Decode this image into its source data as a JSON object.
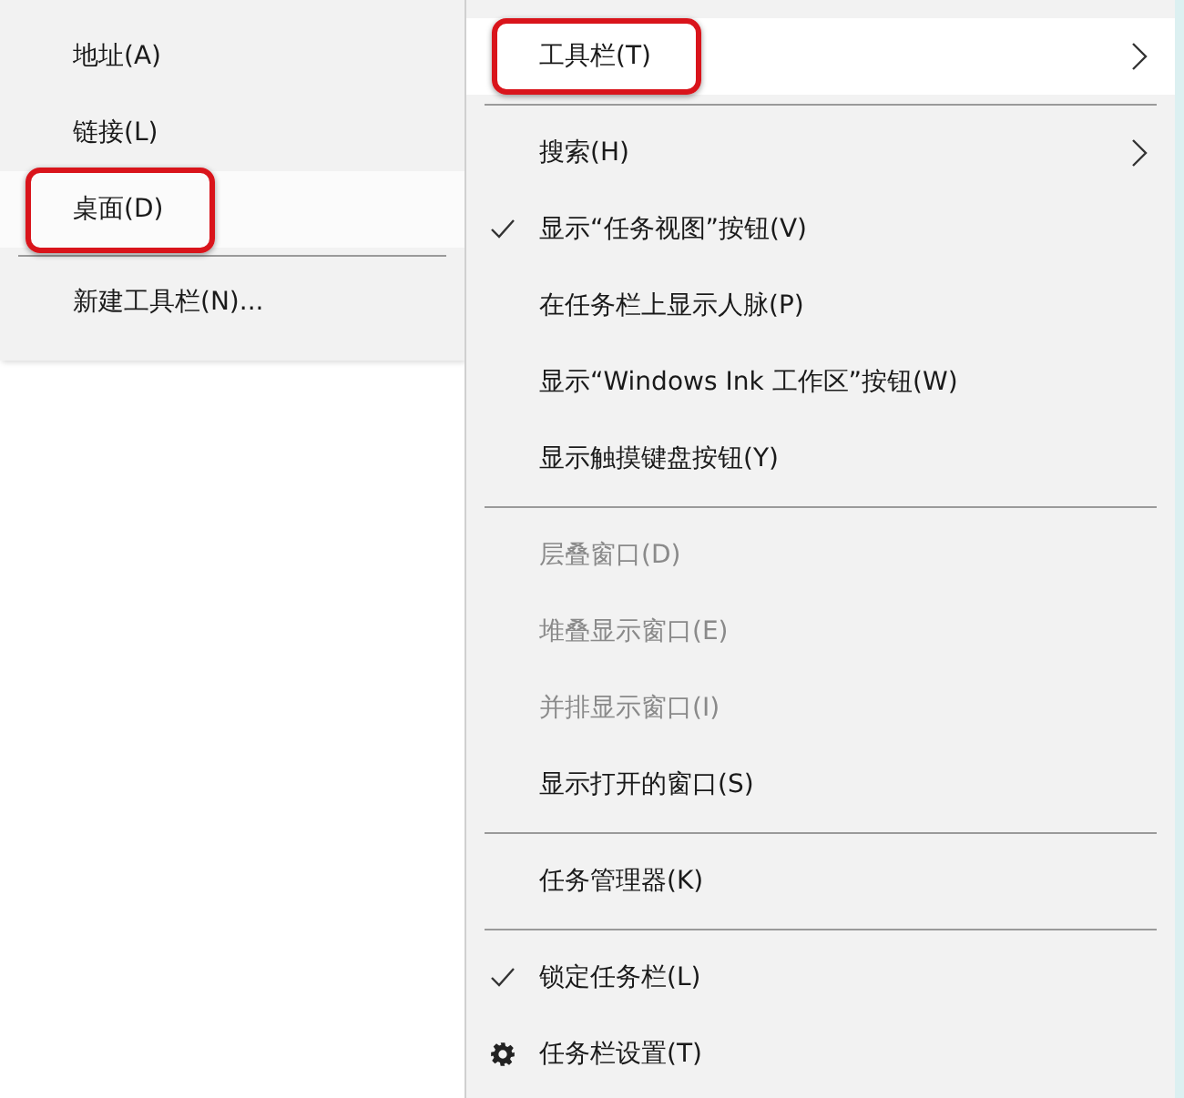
{
  "toolbar_submenu": {
    "items": [
      {
        "kind": "item",
        "label": "地址(A)",
        "selected": false,
        "annotated": false
      },
      {
        "kind": "item",
        "label": "链接(L)",
        "selected": false,
        "annotated": false
      },
      {
        "kind": "item",
        "label": "桌面(D)",
        "selected": true,
        "annotated": true
      },
      {
        "kind": "separator"
      },
      {
        "kind": "item",
        "label": "新建工具栏(N)...",
        "selected": false,
        "annotated": false
      }
    ]
  },
  "context_menu": {
    "items": [
      {
        "kind": "item",
        "label": "工具栏(T)",
        "selected": true,
        "annotated": true,
        "submenu": true,
        "checked": false,
        "disabled": false
      },
      {
        "kind": "separator"
      },
      {
        "kind": "item",
        "label": "搜索(H)",
        "selected": false,
        "annotated": false,
        "submenu": true,
        "checked": false,
        "disabled": false
      },
      {
        "kind": "item",
        "label": "显示“任务视图”按钮(V)",
        "selected": false,
        "annotated": false,
        "submenu": false,
        "checked": true,
        "disabled": false
      },
      {
        "kind": "item",
        "label": "在任务栏上显示人脉(P)",
        "selected": false,
        "annotated": false,
        "submenu": false,
        "checked": false,
        "disabled": false
      },
      {
        "kind": "item",
        "label": "显示“Windows Ink 工作区”按钮(W)",
        "selected": false,
        "annotated": false,
        "submenu": false,
        "checked": false,
        "disabled": false
      },
      {
        "kind": "item",
        "label": "显示触摸键盘按钮(Y)",
        "selected": false,
        "annotated": false,
        "submenu": false,
        "checked": false,
        "disabled": false
      },
      {
        "kind": "separator"
      },
      {
        "kind": "item",
        "label": "层叠窗口(D)",
        "selected": false,
        "annotated": false,
        "submenu": false,
        "checked": false,
        "disabled": true
      },
      {
        "kind": "item",
        "label": "堆叠显示窗口(E)",
        "selected": false,
        "annotated": false,
        "submenu": false,
        "checked": false,
        "disabled": true
      },
      {
        "kind": "item",
        "label": "并排显示窗口(I)",
        "selected": false,
        "annotated": false,
        "submenu": false,
        "checked": false,
        "disabled": true
      },
      {
        "kind": "item",
        "label": "显示打开的窗口(S)",
        "selected": false,
        "annotated": false,
        "submenu": false,
        "checked": false,
        "disabled": false
      },
      {
        "kind": "separator"
      },
      {
        "kind": "item",
        "label": "任务管理器(K)",
        "selected": false,
        "annotated": false,
        "submenu": false,
        "checked": false,
        "disabled": false
      },
      {
        "kind": "separator"
      },
      {
        "kind": "item",
        "label": "锁定任务栏(L)",
        "selected": false,
        "annotated": false,
        "submenu": false,
        "checked": true,
        "disabled": false
      },
      {
        "kind": "gear-item",
        "label": "任务栏设置(T)",
        "selected": false,
        "annotated": false,
        "submenu": false,
        "disabled": false
      }
    ]
  }
}
